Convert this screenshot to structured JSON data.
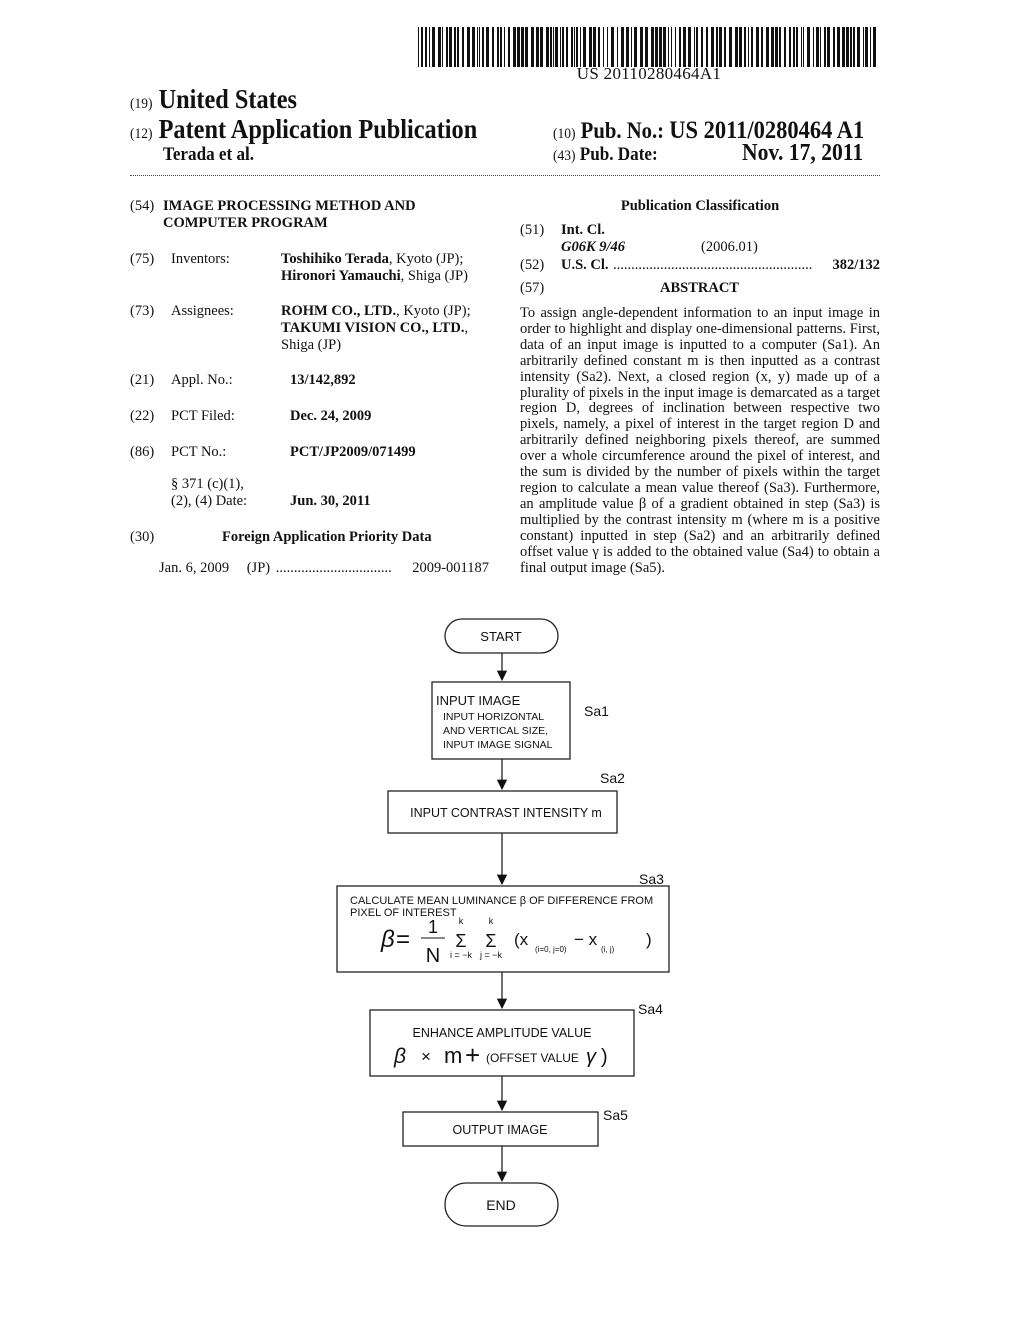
{
  "barcode": {
    "text": "US 20110280464A1"
  },
  "header": {
    "country_code": "(19)",
    "country": "United States",
    "type_code": "(12)",
    "type": "Patent Application Publication",
    "inventors_short": "Terada et al.",
    "pubno_code": "(10)",
    "pubno_label": "Pub. No.:",
    "pubno_value": "US 2011/0280464 A1",
    "pubdate_code": "(43)",
    "pubdate_label": "Pub. Date:",
    "pubdate_value": "Nov. 17, 2011"
  },
  "left": {
    "title": {
      "code": "(54)",
      "lines": [
        "IMAGE PROCESSING METHOD AND",
        "COMPUTER PROGRAM"
      ]
    },
    "inventors": {
      "code": "(75)",
      "label": "Inventors:",
      "entries": [
        {
          "name": "Toshihiko Terada",
          "loc": ", Kyoto (JP);"
        },
        {
          "name": "Hironori Yamauchi",
          "loc": ", Shiga (JP)"
        }
      ]
    },
    "assignees": {
      "code": "(73)",
      "label": "Assignees:",
      "entries": [
        {
          "name": "ROHM CO., LTD.",
          "loc": ", Kyoto (JP);"
        },
        {
          "name": "TAKUMI VISION CO., LTD.",
          "loc": ","
        },
        {
          "name": "",
          "loc": "Shiga (JP)"
        }
      ]
    },
    "appl": {
      "code": "(21)",
      "label": "Appl. No.:",
      "value": "13/142,892"
    },
    "pct_filed": {
      "code": "(22)",
      "label": "PCT Filed:",
      "value": "Dec. 24, 2009"
    },
    "pct_no": {
      "code": "(86)",
      "label": "PCT No.:",
      "value": "PCT/JP2009/071499"
    },
    "s371": {
      "label1": "§ 371 (c)(1),",
      "label2": "(2), (4) Date:",
      "value": "Jun. 30, 2011"
    },
    "foreign": {
      "code": "(30)",
      "heading": "Foreign Application Priority Data",
      "date": "Jan. 6, 2009",
      "country": "(JP)",
      "dots": "................................",
      "number": "2009-001187"
    }
  },
  "right": {
    "classification_heading": "Publication Classification",
    "intcl": {
      "code": "(51)",
      "label": "Int. Cl.",
      "class": "G06K 9/46",
      "year": "(2006.01)"
    },
    "uscl": {
      "code": "(52)",
      "label": "U.S. Cl.",
      "dots": ".......................................................",
      "value": "382/132"
    },
    "abstract_code": "(57)",
    "abstract_heading": "ABSTRACT",
    "abstract_text": "To assign angle-dependent information to an input image in order to highlight and display one-dimensional patterns. First, data of an input image is inputted to a computer (Sa1). An arbitrarily defined constant m is then inputted as a contrast intensity (Sa2). Next, a closed region (x, y) made up of a plurality of pixels in the input image is demarcated as a target region D, degrees of inclination between respective two pixels, namely, a pixel of interest in the target region D and arbitrarily defined neighboring pixels thereof, are summed over a whole circumference around the pixel of interest, and the sum is divided by the number of pixels within the target region to calculate a mean value thereof (Sa3). Furthermore, an amplitude value β of a gradient obtained in step (Sa3) is multiplied by the contrast intensity m (where m is a positive constant) inputted in step (Sa2) and an arbitrarily defined offset value γ is added to the obtained value (Sa4) to obtain a final output image (Sa5)."
  },
  "flowchart": {
    "start": "START",
    "sa1": {
      "label": "Sa1",
      "title": "INPUT IMAGE",
      "lines": [
        "INPUT HORIZONTAL",
        "AND VERTICAL SIZE,",
        "INPUT IMAGE SIGNAL"
      ]
    },
    "sa2": {
      "label": "Sa2",
      "text": "INPUT CONTRAST INTENSITY m"
    },
    "sa3": {
      "label": "Sa3",
      "line1": "CALCULATE MEAN LUMINANCE β  OF DIFFERENCE FROM",
      "line2": "PIXEL OF INTEREST",
      "beta": "β",
      "eq": "=",
      "num": "1",
      "den": "N",
      "sigma": "Σ",
      "k": "k",
      "ilim": "i = −k",
      "jlim": "j = −k",
      "open": "(x",
      "sub1": "(i=0, j=0)",
      "minus": "− x",
      "sub2": "(i,  j)",
      "close": ")"
    },
    "sa4": {
      "label": "Sa4",
      "title": "ENHANCE AMPLITUDE VALUE",
      "beta": "β",
      "times": "×",
      "m": "m",
      "plus": "+",
      "offset": "(OFFSET VALUE",
      "gamma": "γ",
      "close": ")"
    },
    "sa5": {
      "label": "Sa5",
      "text": "OUTPUT IMAGE"
    },
    "end": "END"
  }
}
